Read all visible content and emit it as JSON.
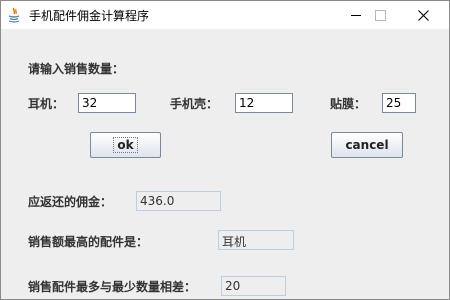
{
  "window": {
    "title": "手机配件佣金计算程序"
  },
  "form": {
    "prompt": "请输入销售数量：",
    "earphone": {
      "label": "耳机：",
      "value": "32"
    },
    "phone_case": {
      "label": "手机壳：",
      "value": "12"
    },
    "screen_film": {
      "label": "贴膜：",
      "value": "25"
    }
  },
  "buttons": {
    "ok": "ok",
    "cancel": "cancel"
  },
  "results": {
    "commission": {
      "label": "应返还的佣金：",
      "value": "436.0"
    },
    "top_seller": {
      "label": "销售额最高的配件是：",
      "value": "耳机"
    },
    "difference": {
      "label": "销售配件最多与最少数量相差：",
      "value": "20"
    }
  },
  "icons": {
    "app": "java-icon",
    "minimize": "minimize-icon",
    "maximize": "maximize-icon",
    "close": "close-icon"
  }
}
